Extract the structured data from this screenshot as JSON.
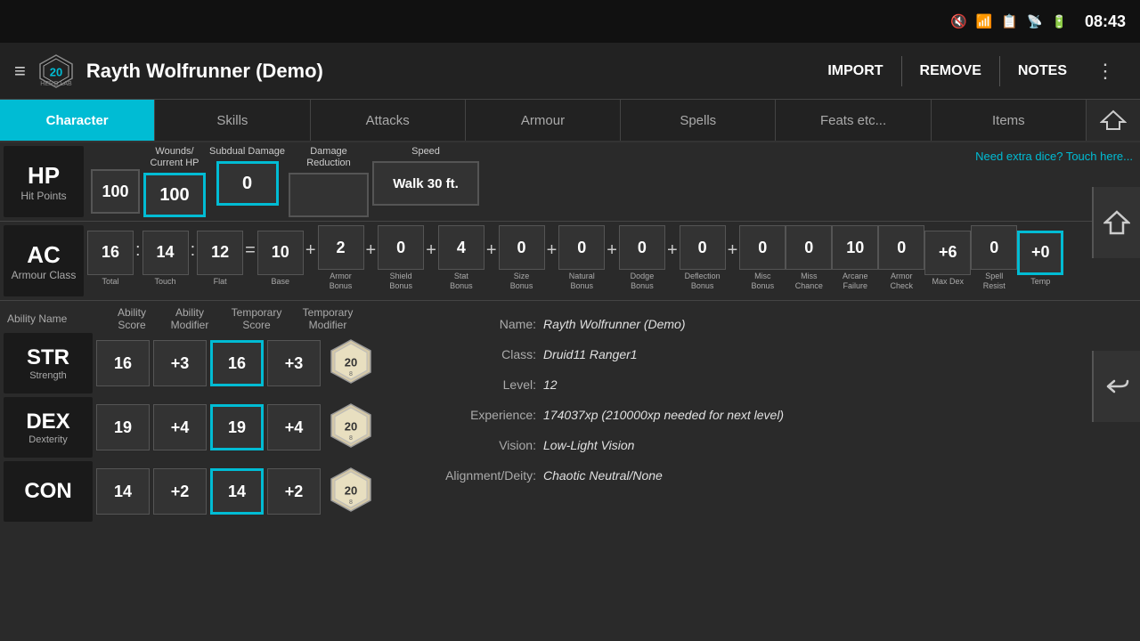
{
  "statusBar": {
    "time": "08:43",
    "icons": [
      "mute-icon",
      "wifi-icon",
      "sim-icon",
      "signal-icon",
      "battery-icon"
    ]
  },
  "appBar": {
    "hamburger": "≡",
    "title": "Rayth Wolfrunner (Demo)",
    "actions": [
      "IMPORT",
      "REMOVE",
      "NOTES"
    ],
    "more": "⋮"
  },
  "tabs": [
    {
      "label": "Character",
      "active": true
    },
    {
      "label": "Skills",
      "active": false
    },
    {
      "label": "Attacks",
      "active": false
    },
    {
      "label": "Armour",
      "active": false
    },
    {
      "label": "Spells",
      "active": false
    },
    {
      "label": "Feats etc...",
      "active": false
    },
    {
      "label": "Items",
      "active": false
    }
  ],
  "hp": {
    "label": "HP",
    "sublabel": "Hit Points",
    "currentValue": "100",
    "woundsLabel": "Wounds/\nCurrent HP",
    "subdualLabel": "Subdual Damage",
    "subdualValue": "0",
    "damageReductionLabel": "Damage\nReduction",
    "damageReductionValue": "",
    "speedLabel": "Speed",
    "speedValue": "Walk 30 ft.",
    "diceLink": "Need extra dice?  Touch here..."
  },
  "ac": {
    "label": "AC",
    "sublabel": "Armour Class",
    "values": [
      {
        "val": "16",
        "sub": "Total"
      },
      {
        "val": "14",
        "sub": "Touch"
      },
      {
        "val": "12",
        "sub": "Flat"
      },
      {
        "val": "10",
        "sub": "Base"
      },
      {
        "val": "2",
        "sub": "Armor\nBonus"
      },
      {
        "val": "0",
        "sub": "Shield\nBonus"
      },
      {
        "val": "4",
        "sub": "Stat\nBonus"
      },
      {
        "val": "0",
        "sub": "Size\nBonus"
      },
      {
        "val": "0",
        "sub": "Natural\nBonus"
      },
      {
        "val": "0",
        "sub": "Dodge\nBonus"
      },
      {
        "val": "0",
        "sub": "Deflection\nBonus"
      },
      {
        "val": "0",
        "sub": "Misc\nBonus"
      },
      {
        "val": "0",
        "sub": "Miss\nChance"
      },
      {
        "val": "10",
        "sub": "Arcane\nFailure"
      },
      {
        "val": "0",
        "sub": "Armor\nCheck"
      },
      {
        "val": "+6",
        "sub": "Max Dex"
      },
      {
        "val": "0",
        "sub": "Spell\nResist"
      },
      {
        "val": "+0",
        "sub": "Temp",
        "highlight": true
      }
    ],
    "separators": [
      {
        "after": 2,
        "char": ":"
      },
      {
        "after": 3,
        "char": "="
      },
      {
        "after": 4,
        "char": "+"
      },
      {
        "after": 5,
        "char": "+"
      },
      {
        "after": 6,
        "char": "+"
      },
      {
        "after": 7,
        "char": "+"
      },
      {
        "after": 8,
        "char": "+"
      },
      {
        "after": 9,
        "char": "+"
      },
      {
        "after": 10,
        "char": "+"
      },
      {
        "after": 11,
        "char": "+"
      }
    ]
  },
  "abilityHeaders": {
    "name": "Ability Name",
    "score": "Ability\nScore",
    "modifier": "Ability\nModifier",
    "tempScore": "Temporary\nScore",
    "tempMod": "Temporary\nModifier"
  },
  "abilities": [
    {
      "abbr": "STR",
      "name": "Strength",
      "score": "16",
      "modifier": "+3",
      "tempScore": "16",
      "tempMod": "+3"
    },
    {
      "abbr": "DEX",
      "name": "Dexterity",
      "score": "19",
      "modifier": "+4",
      "tempScore": "19",
      "tempMod": "+4"
    },
    {
      "abbr": "CON",
      "name": "",
      "score": "14",
      "modifier": "+2",
      "tempScore": "14",
      "tempMod": "+2"
    }
  ],
  "charInfo": {
    "name": {
      "label": "Name:",
      "value": "Rayth Wolfrunner (Demo)"
    },
    "class": {
      "label": "Class:",
      "value": "Druid11 Ranger1"
    },
    "level": {
      "label": "Level:",
      "value": "12"
    },
    "experience": {
      "label": "Experience:",
      "value": "174037xp (210000xp needed for next level)"
    },
    "vision": {
      "label": "Vision:",
      "value": "Low-Light Vision"
    },
    "alignment": {
      "label": "Alignment/Deity:",
      "value": "Chaotic Neutral/None"
    }
  },
  "sideButtons": {
    "home": "⌂",
    "back": "↩"
  }
}
